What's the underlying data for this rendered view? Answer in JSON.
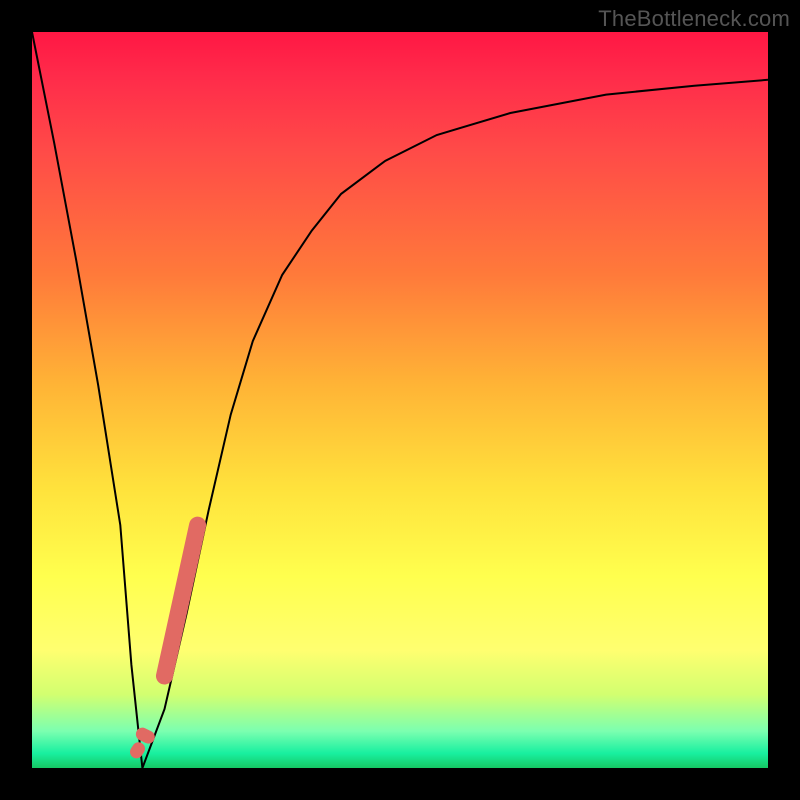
{
  "watermark": {
    "text": "TheBottleneck.com"
  },
  "chart_data": {
    "type": "line",
    "title": "",
    "xlabel": "",
    "ylabel": "",
    "xlim": [
      0,
      100
    ],
    "ylim": [
      0,
      100
    ],
    "grid": false,
    "legend": false,
    "series": [
      {
        "name": "bottleneck-curve",
        "color": "#000000",
        "x": [
          0,
          3,
          6,
          9,
          12,
          13.5,
          15,
          18,
          21,
          24,
          27,
          30,
          34,
          38,
          42,
          48,
          55,
          65,
          78,
          90,
          100
        ],
        "y": [
          100,
          85,
          69,
          52,
          33,
          14,
          0,
          8,
          21,
          35,
          48,
          58,
          67,
          73,
          78,
          82.5,
          86,
          89,
          91.5,
          92.7,
          93.5
        ]
      },
      {
        "name": "highlight-segment",
        "color": "#e16a63",
        "points": [
          {
            "x": 14.2,
            "y": 2.2
          },
          {
            "x": 15.0,
            "y": 4.6
          },
          {
            "x": 15.8,
            "y": 4.2
          },
          {
            "x": 18.0,
            "y": 12.5
          },
          {
            "x": 22.5,
            "y": 33.0
          }
        ]
      }
    ]
  }
}
